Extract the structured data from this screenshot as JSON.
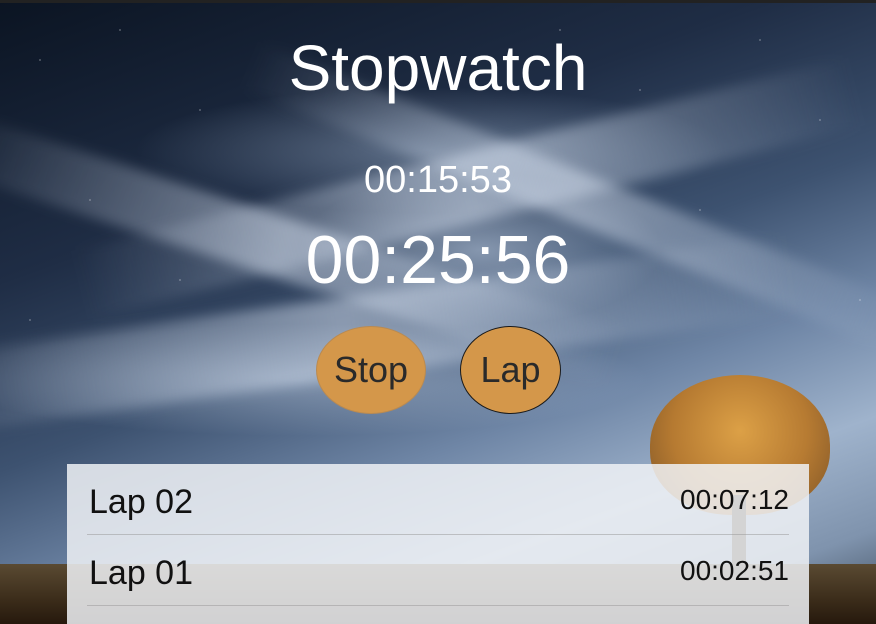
{
  "app": {
    "title": "Stopwatch"
  },
  "timer": {
    "lap_time": "00:15:53",
    "total_time": "00:25:56"
  },
  "controls": {
    "stop_label": "Stop",
    "lap_label": "Lap"
  },
  "laps": [
    {
      "label": "Lap 02",
      "time": "00:07:12"
    },
    {
      "label": "Lap 01",
      "time": "00:02:51"
    }
  ],
  "colors": {
    "button_fill": "#d4974a",
    "text_primary": "#ffffff",
    "lap_panel": "#f0f2f6"
  }
}
